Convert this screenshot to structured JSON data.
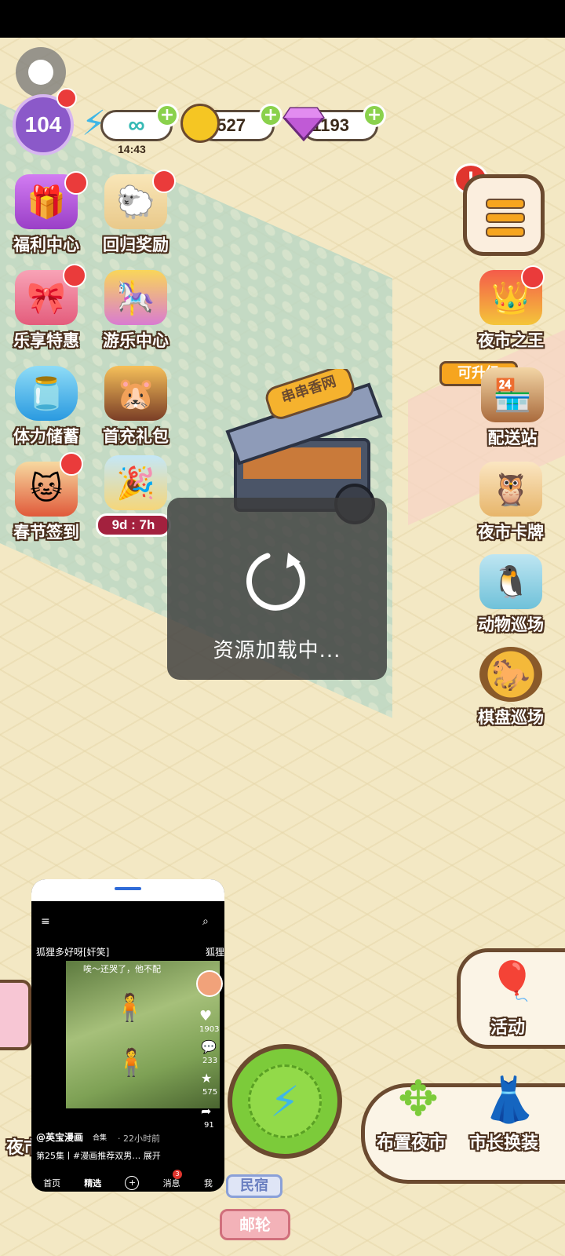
{
  "hud": {
    "level": "104",
    "energy_timer": "14:43",
    "energy_value": "∞",
    "coins": "54527",
    "gems": "1193"
  },
  "left_features": [
    {
      "label": "福利中心",
      "icon": "gift-icon"
    },
    {
      "label": "回归奖励",
      "icon": "return-reward-icon"
    },
    {
      "label": "乐享特惠",
      "icon": "discount-icon"
    },
    {
      "label": "游乐中心",
      "icon": "carousel-icon"
    },
    {
      "label": "体力储蓄",
      "icon": "energy-jar-icon"
    },
    {
      "label": "首充礼包",
      "icon": "first-recharge-icon"
    },
    {
      "label": "春节签到",
      "icon": "spring-festival-icon"
    }
  ],
  "event_timer": "9d : 7h",
  "right_features": [
    {
      "label": "夜市之王",
      "icon": "crown-icon"
    },
    {
      "label": "配送站",
      "icon": "delivery-station-icon"
    },
    {
      "label": "夜市卡牌",
      "icon": "cards-icon"
    },
    {
      "label": "动物巡场",
      "icon": "animal-icon"
    },
    {
      "label": "棋盘巡场",
      "icon": "board-icon"
    }
  ],
  "upgrade_badge": "可升级",
  "stall_sign": "串串香网",
  "loading_text": "资源加载中...",
  "activity_label": "活动",
  "bottom_buttons": [
    {
      "label": "布置夜市"
    },
    {
      "label": "市长换装"
    }
  ],
  "partial_left_label": "夜市",
  "bottom_tags": {
    "blue": "民宿",
    "pink": "邮轮"
  },
  "pip": {
    "title": "狐狸多好呀[奸笑]",
    "title_right": "狐狸",
    "caption_top": "唉～还哭了，他不配",
    "likes": "1903",
    "comments": "233",
    "favorites": "575",
    "shares": "91",
    "author": "@英宝漫画",
    "collection": "合集",
    "time": "· 22小时前",
    "desc": "第25集丨#漫画推荐双男… 展开",
    "nav": [
      "首页",
      "精选",
      "+",
      "消息",
      "我"
    ],
    "msg_badge": "3"
  },
  "colors": {
    "accent_green": "#8ad14c",
    "alert_red": "#e0352e",
    "border_brown": "#6b4a2f",
    "gem_purple": "#c05ad6",
    "coin_gold": "#f5c623"
  }
}
